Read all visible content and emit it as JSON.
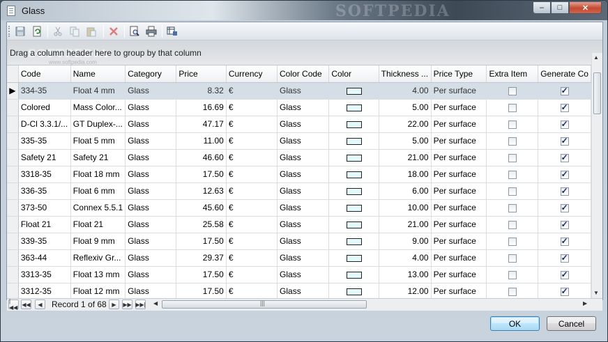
{
  "window": {
    "title": "Glass",
    "watermark": "SOFTPEDIA",
    "controls": {
      "minimize": "–",
      "maximize": "□",
      "close": "✕"
    }
  },
  "toolbar": {
    "buttons": [
      {
        "name": "save-icon",
        "color": "#8a9aaa"
      },
      {
        "name": "refresh-icon",
        "color": "#3a8a3a"
      },
      {
        "name": "cut-icon",
        "color": "#9aa4ae"
      },
      {
        "name": "copy-icon",
        "color": "#9aa4ae"
      },
      {
        "name": "paste-icon",
        "color": "#9aa4ae"
      },
      {
        "name": "delete-icon",
        "color": "#d04040"
      },
      {
        "name": "print-preview-icon",
        "color": "#345"
      },
      {
        "name": "print-icon",
        "color": "#345"
      },
      {
        "name": "export-icon",
        "color": "#345"
      }
    ]
  },
  "group_panel": {
    "text": "Drag a column header here to group by that column",
    "watermark": "SOFTPEDIA",
    "watermark_small": "www.softpedia.com"
  },
  "grid": {
    "columns": [
      "Code",
      "Name",
      "Category",
      "Price",
      "Currency",
      "Color Code",
      "Color",
      "Thickness ...",
      "Price Type",
      "Extra Item",
      "Generate Co"
    ],
    "selected_row": 0,
    "row_indicator": "▶",
    "rows": [
      {
        "code": "334-35",
        "name": "Float 4 mm",
        "category": "Glass",
        "price": "8.32",
        "currency": "€",
        "color_code": "Glass",
        "thickness": "4.00",
        "price_type": "Per surface",
        "extra": false,
        "generate": true
      },
      {
        "code": "Colored",
        "name": "Mass Color...",
        "category": "Glass",
        "price": "16.69",
        "currency": "€",
        "color_code": "Glass",
        "thickness": "5.00",
        "price_type": "Per surface",
        "extra": false,
        "generate": true
      },
      {
        "code": "D-Cl 3.3.1/...",
        "name": "GT Duplex-...",
        "category": "Glass",
        "price": "47.17",
        "currency": "€",
        "color_code": "Glass",
        "thickness": "22.00",
        "price_type": "Per surface",
        "extra": false,
        "generate": true
      },
      {
        "code": "335-35",
        "name": "Float 5 mm",
        "category": "Glass",
        "price": "11.00",
        "currency": "€",
        "color_code": "Glass",
        "thickness": "5.00",
        "price_type": "Per surface",
        "extra": false,
        "generate": true
      },
      {
        "code": "Safety 21",
        "name": "Safety 21",
        "category": "Glass",
        "price": "46.60",
        "currency": "€",
        "color_code": "Glass",
        "thickness": "21.00",
        "price_type": "Per surface",
        "extra": false,
        "generate": true
      },
      {
        "code": "3318-35",
        "name": "Float 18 mm",
        "category": "Glass",
        "price": "17.50",
        "currency": "€",
        "color_code": "Glass",
        "thickness": "18.00",
        "price_type": "Per surface",
        "extra": false,
        "generate": true
      },
      {
        "code": "336-35",
        "name": "Float 6 mm",
        "category": "Glass",
        "price": "12.63",
        "currency": "€",
        "color_code": "Glass",
        "thickness": "6.00",
        "price_type": "Per surface",
        "extra": false,
        "generate": true
      },
      {
        "code": "373-50",
        "name": "Connex 5.5.1",
        "category": "Glass",
        "price": "45.60",
        "currency": "€",
        "color_code": "Glass",
        "thickness": "10.00",
        "price_type": "Per surface",
        "extra": false,
        "generate": true
      },
      {
        "code": "Float 21",
        "name": "Float 21",
        "category": "Glass",
        "price": "25.58",
        "currency": "€",
        "color_code": "Glass",
        "thickness": "21.00",
        "price_type": "Per surface",
        "extra": false,
        "generate": true
      },
      {
        "code": "339-35",
        "name": "Float 9 mm",
        "category": "Glass",
        "price": "17.50",
        "currency": "€",
        "color_code": "Glass",
        "thickness": "9.00",
        "price_type": "Per surface",
        "extra": false,
        "generate": true
      },
      {
        "code": "363-44",
        "name": "Reflexiv Gr...",
        "category": "Glass",
        "price": "29.37",
        "currency": "€",
        "color_code": "Glass",
        "thickness": "4.00",
        "price_type": "Per surface",
        "extra": false,
        "generate": true
      },
      {
        "code": "3313-35",
        "name": "Float 13 mm",
        "category": "Glass",
        "price": "17.50",
        "currency": "€",
        "color_code": "Glass",
        "thickness": "13.00",
        "price_type": "Per surface",
        "extra": false,
        "generate": true
      },
      {
        "code": "3312-35",
        "name": "Float 12 mm",
        "category": "Glass",
        "price": "17.50",
        "currency": "€",
        "color_code": "Glass",
        "thickness": "12.00",
        "price_type": "Per surface",
        "extra": false,
        "generate": true
      }
    ],
    "swatch_color": "#e3f9fb"
  },
  "navigator": {
    "first": "|◀◀",
    "prev_page": "◀◀",
    "prev": "◀",
    "record_text": "Record 1 of 68",
    "next": "▶",
    "next_page": "▶▶",
    "last": "▶▶|"
  },
  "buttons": {
    "ok": "OK",
    "cancel": "Cancel"
  }
}
